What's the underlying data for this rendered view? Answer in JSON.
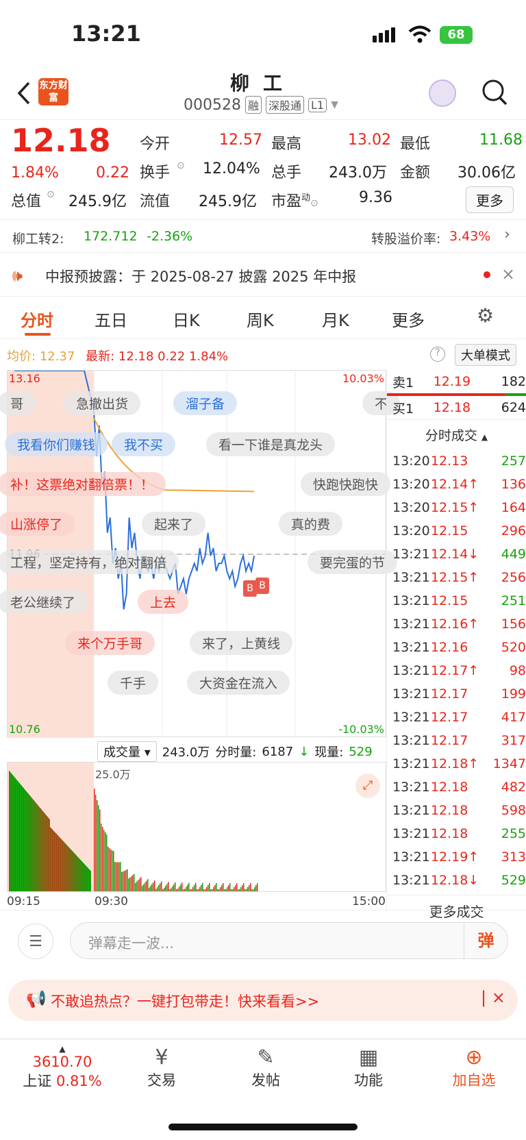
{
  "status": {
    "time": "13:21",
    "battery": "68"
  },
  "header": {
    "title": "柳工",
    "code": "000528",
    "tags": [
      "融",
      "深股通",
      "L1"
    ],
    "logo": "东方财富"
  },
  "quote": {
    "price": "12.18",
    "change_pct": "1.84%",
    "change": "0.22",
    "open_label": "今开",
    "open": "12.57",
    "high_label": "最高",
    "high": "13.02",
    "low_label": "最低",
    "low": "11.68",
    "turnover_label": "换手",
    "turnover": "12.04%",
    "volume_label": "总手",
    "volume": "243.0万",
    "amount_label": "金额",
    "amount": "30.06亿",
    "mktcap_label": "总值",
    "mktcap": "245.9亿",
    "float_label": "流值",
    "float": "245.9亿",
    "pe_label": "市盈",
    "pe_sup": "动",
    "pe": "9.36",
    "more": "更多"
  },
  "bond": {
    "name": "柳工转2:",
    "price": "172.712",
    "change": "-2.36%",
    "premium_label": "转股溢价率:",
    "premium": "3.43%"
  },
  "notice": {
    "text": "中报预披露：于 2025-08-27 披露 2025 年中报"
  },
  "tabs": [
    "分时",
    "五日",
    "日K",
    "周K",
    "月K",
    "更多"
  ],
  "chart_info": {
    "avg_label": "均价:",
    "avg": "12.37",
    "last_label": "最新:",
    "last": "12.18",
    "chg": "0.22",
    "pct": "1.84%",
    "mode": "大单模式"
  },
  "chart_data": {
    "type": "line",
    "y_top": "13.16",
    "y_bottom": "10.76",
    "y_mid": "11.96",
    "pct_top": "10.03%",
    "pct_bottom": "-10.03%",
    "x_labels": [
      "09:15",
      "09:30",
      "15:00"
    ],
    "vol_label": "25.0万",
    "prices": [
      12.9,
      12.6,
      12.8,
      12.4,
      12.5,
      12.1,
      12.2,
      11.9,
      12.0,
      11.8,
      11.9,
      11.6,
      11.7,
      12.2,
      12.0,
      12.1,
      11.9,
      11.8,
      11.95,
      11.9,
      11.85,
      11.9,
      11.8,
      11.9,
      11.85,
      11.95,
      11.9,
      11.85,
      11.8,
      11.85,
      11.9,
      11.7,
      11.75,
      11.8,
      11.7,
      11.8,
      11.85,
      11.9,
      11.85,
      12.0,
      11.9,
      11.95,
      12.1,
      11.95,
      12.0,
      11.85,
      11.9,
      11.9,
      11.95,
      11.85,
      11.8,
      11.85,
      11.75,
      11.8,
      11.9,
      11.95,
      11.85,
      11.9,
      11.85,
      11.95
    ]
  },
  "danmaku": [
    "哥",
    "急撤出货",
    "溜子备",
    "不",
    "我看你们赚钱",
    "我不买",
    "看一下谁是真龙头",
    "补！这票绝对翻倍票！！",
    "快跑快跑快",
    "山涨停了",
    "起来了",
    "真的费",
    "工程，坚定持有，绝对翻倍",
    "要完蛋的节",
    "老公继续了",
    "上去",
    "来个万手哥",
    "来了，上黄线",
    "千手",
    "大资金在流入"
  ],
  "volume_bar": {
    "label": "成交量",
    "total": "243.0万",
    "period_label": "分时量:",
    "period": "6187",
    "now_label": "现量:",
    "now": "529"
  },
  "orderbook": {
    "sell_label": "卖1",
    "sell_price": "12.19",
    "sell_vol": "182",
    "buy_label": "买1",
    "buy_price": "12.18",
    "buy_vol": "624"
  },
  "trades_title": "分时成交",
  "trades": [
    {
      "t": "13:20",
      "p": "12.13",
      "v": "257",
      "c": "red",
      "vc": "green"
    },
    {
      "t": "13:20",
      "p": "12.14↑",
      "v": "136",
      "c": "red",
      "vc": "red"
    },
    {
      "t": "13:20",
      "p": "12.15↑",
      "v": "164",
      "c": "red",
      "vc": "red"
    },
    {
      "t": "13:20",
      "p": "12.15",
      "v": "296",
      "c": "red",
      "vc": "red"
    },
    {
      "t": "13:21",
      "p": "12.14↓",
      "v": "449",
      "c": "red",
      "vc": "green"
    },
    {
      "t": "13:21",
      "p": "12.15↑",
      "v": "256",
      "c": "red",
      "vc": "red"
    },
    {
      "t": "13:21",
      "p": "12.15",
      "v": "251",
      "c": "red",
      "vc": "green"
    },
    {
      "t": "13:21",
      "p": "12.16↑",
      "v": "156",
      "c": "red",
      "vc": "red"
    },
    {
      "t": "13:21",
      "p": "12.16",
      "v": "520",
      "c": "red",
      "vc": "red"
    },
    {
      "t": "13:21",
      "p": "12.17↑",
      "v": "98",
      "c": "red",
      "vc": "red"
    },
    {
      "t": "13:21",
      "p": "12.17",
      "v": "199",
      "c": "red",
      "vc": "red"
    },
    {
      "t": "13:21",
      "p": "12.17",
      "v": "417",
      "c": "red",
      "vc": "red"
    },
    {
      "t": "13:21",
      "p": "12.17",
      "v": "317",
      "c": "red",
      "vc": "red"
    },
    {
      "t": "13:21",
      "p": "12.18↑",
      "v": "1347",
      "c": "red",
      "vc": "red"
    },
    {
      "t": "13:21",
      "p": "12.18",
      "v": "482",
      "c": "red",
      "vc": "red"
    },
    {
      "t": "13:21",
      "p": "12.18",
      "v": "598",
      "c": "red",
      "vc": "red"
    },
    {
      "t": "13:21",
      "p": "12.18",
      "v": "255",
      "c": "red",
      "vc": "green"
    },
    {
      "t": "13:21",
      "p": "12.19↑",
      "v": "313",
      "c": "red",
      "vc": "red"
    },
    {
      "t": "13:21",
      "p": "12.18↓",
      "v": "529",
      "c": "red",
      "vc": "green"
    }
  ],
  "more_trades": "更多成交",
  "comment": {
    "placeholder": "弹幕走一波...",
    "danmu_btn": "弹"
  },
  "promo": {
    "text": "不敢追热点？一键打包带走！快来看看>>"
  },
  "nav": {
    "index_value": "3610.70",
    "index_name": "上证",
    "index_pct": "0.81%",
    "trade": "交易",
    "post": "发帖",
    "func": "功能",
    "add": "加自选"
  }
}
